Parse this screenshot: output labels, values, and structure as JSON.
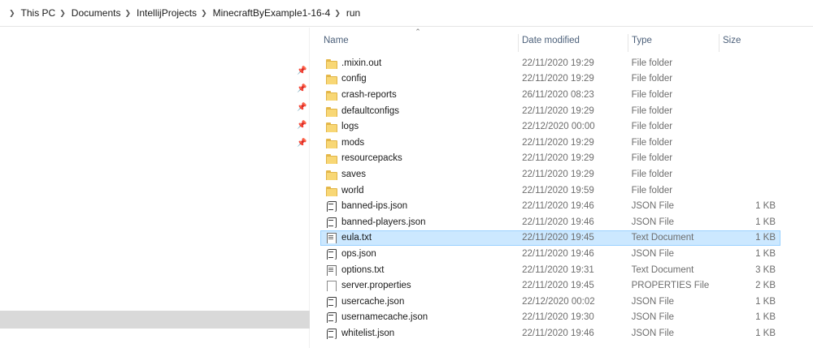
{
  "breadcrumb": [
    "This PC",
    "Documents",
    "IntellijProjects",
    "MinecraftByExample1-16-4",
    "run"
  ],
  "columns": {
    "name": "Name",
    "date": "Date modified",
    "type": "Type",
    "size": "Size"
  },
  "files": [
    {
      "name": ".mixin.out",
      "date": "22/11/2020 19:29",
      "type": "File folder",
      "size": "",
      "icon": "folder-icon"
    },
    {
      "name": "config",
      "date": "22/11/2020 19:29",
      "type": "File folder",
      "size": "",
      "icon": "folder-icon"
    },
    {
      "name": "crash-reports",
      "date": "26/11/2020 08:23",
      "type": "File folder",
      "size": "",
      "icon": "folder-icon"
    },
    {
      "name": "defaultconfigs",
      "date": "22/11/2020 19:29",
      "type": "File folder",
      "size": "",
      "icon": "folder-icon"
    },
    {
      "name": "logs",
      "date": "22/12/2020 00:00",
      "type": "File folder",
      "size": "",
      "icon": "folder-icon"
    },
    {
      "name": "mods",
      "date": "22/11/2020 19:29",
      "type": "File folder",
      "size": "",
      "icon": "folder-icon"
    },
    {
      "name": "resourcepacks",
      "date": "22/11/2020 19:29",
      "type": "File folder",
      "size": "",
      "icon": "folder-icon"
    },
    {
      "name": "saves",
      "date": "22/11/2020 19:29",
      "type": "File folder",
      "size": "",
      "icon": "folder-icon"
    },
    {
      "name": "world",
      "date": "22/11/2020 19:59",
      "type": "File folder",
      "size": "",
      "icon": "folder-icon"
    },
    {
      "name": "banned-ips.json",
      "date": "22/11/2020 19:46",
      "type": "JSON File",
      "size": "1 KB",
      "icon": "json-file-icon"
    },
    {
      "name": "banned-players.json",
      "date": "22/11/2020 19:46",
      "type": "JSON File",
      "size": "1 KB",
      "icon": "json-file-icon"
    },
    {
      "name": "eula.txt",
      "date": "22/11/2020 19:45",
      "type": "Text Document",
      "size": "1 KB",
      "icon": "text-file-icon",
      "selected": true
    },
    {
      "name": "ops.json",
      "date": "22/11/2020 19:46",
      "type": "JSON File",
      "size": "1 KB",
      "icon": "json-file-icon"
    },
    {
      "name": "options.txt",
      "date": "22/11/2020 19:31",
      "type": "Text Document",
      "size": "3 KB",
      "icon": "text-file-icon"
    },
    {
      "name": "server.properties",
      "date": "22/11/2020 19:45",
      "type": "PROPERTIES File",
      "size": "2 KB",
      "icon": "blank-file-icon"
    },
    {
      "name": "usercache.json",
      "date": "22/12/2020 00:02",
      "type": "JSON File",
      "size": "1 KB",
      "icon": "json-file-icon"
    },
    {
      "name": "usernamecache.json",
      "date": "22/11/2020 19:30",
      "type": "JSON File",
      "size": "1 KB",
      "icon": "json-file-icon"
    },
    {
      "name": "whitelist.json",
      "date": "22/11/2020 19:46",
      "type": "JSON File",
      "size": "1 KB",
      "icon": "json-file-icon"
    }
  ],
  "colors": {
    "selection": "#cce8ff",
    "selection_border": "#99d1ff",
    "header_text": "#4c607a"
  }
}
